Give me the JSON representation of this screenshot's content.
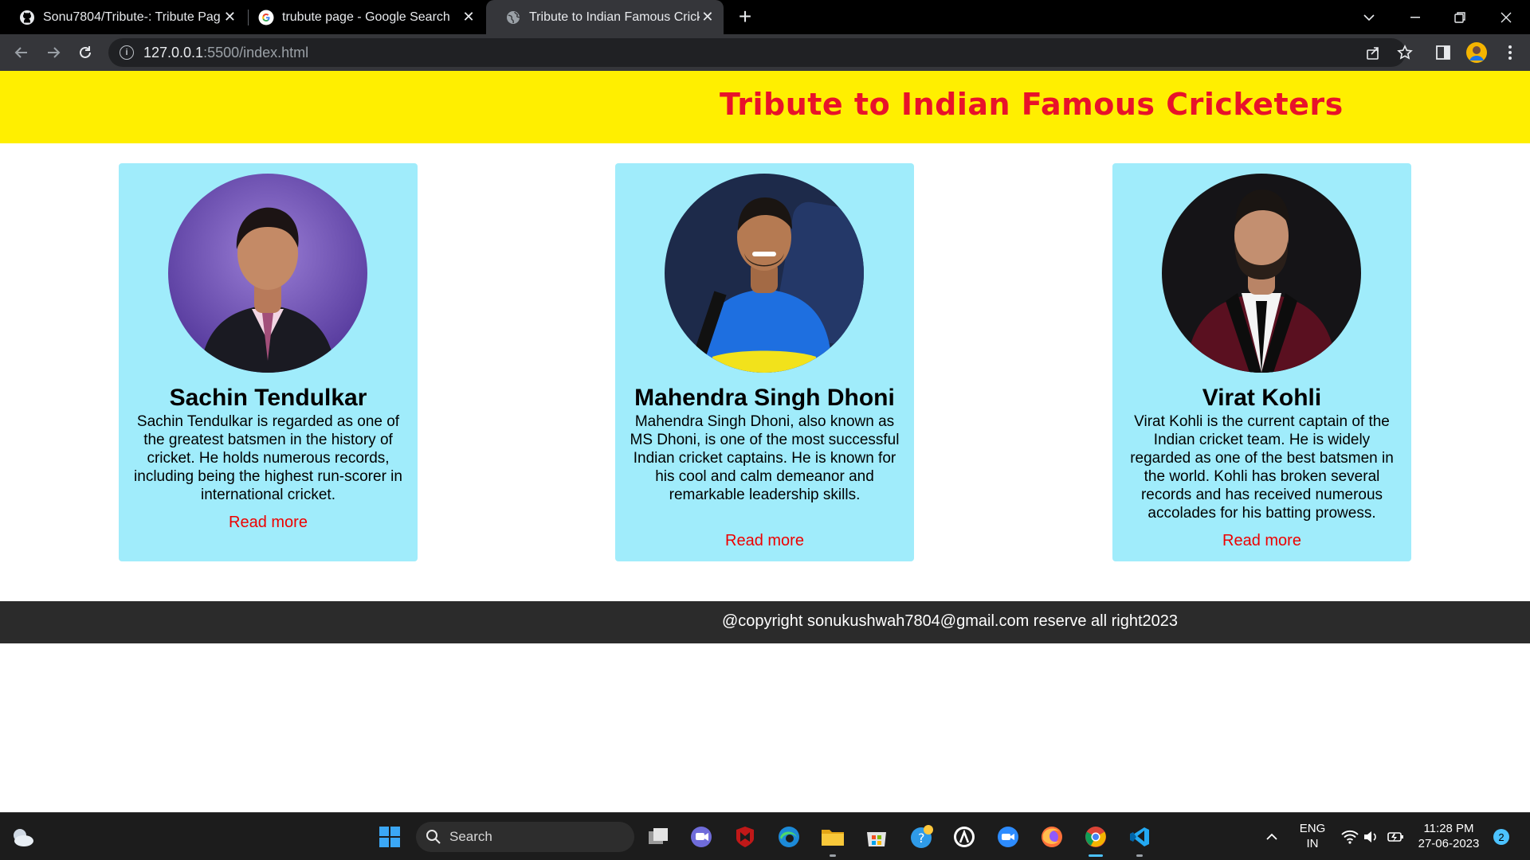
{
  "browser": {
    "tabs": [
      {
        "title": "Sonu7804/Tribute-: Tribute Page",
        "icon": "github-icon"
      },
      {
        "title": "trubute page - Google Search",
        "icon": "google-icon"
      },
      {
        "title": "Tribute to Indian Famous Cricketers",
        "icon": "globe-icon",
        "active": true
      }
    ],
    "url_host": "127.0.0.1",
    "url_path": ":5500/index.html"
  },
  "page": {
    "title": "Tribute to Indian Famous Cricketers",
    "cards": [
      {
        "name": "Sachin Tendulkar",
        "description": "Sachin Tendulkar is regarded as one of the greatest batsmen in the history of cricket. He holds numerous records, including being the highest run-scorer in international cricket.",
        "link": "Read more",
        "photo": "sachin-portrait"
      },
      {
        "name": "Mahendra Singh Dhoni",
        "description": "Mahendra Singh Dhoni, also known as MS Dhoni, is one of the most successful Indian cricket captains. He is known for his cool and calm demeanor and remarkable leadership skills.",
        "link": "Read more",
        "photo": "dhoni-portrait"
      },
      {
        "name": "Virat Kohli",
        "description": "Virat Kohli is the current captain of the Indian cricket team. He is widely regarded as one of the best batsmen in the world. Kohli has broken several records and has received numerous accolades for his batting prowess.",
        "link": "Read more",
        "photo": "kohli-portrait"
      }
    ],
    "footer": "@copyright sonukushwah7804@gmail.com reserve all right2023"
  },
  "taskbar": {
    "search_label": "Search",
    "lang": "ENG",
    "region": "IN",
    "time": "11:28 PM",
    "date": "27-06-2023",
    "notification_count": "2"
  },
  "colors": {
    "header_bg": "#ffef00",
    "title": "#e8122a",
    "card_bg": "#a0ecfb",
    "link": "#ee0000",
    "footer_bg": "#2b2b2b"
  }
}
